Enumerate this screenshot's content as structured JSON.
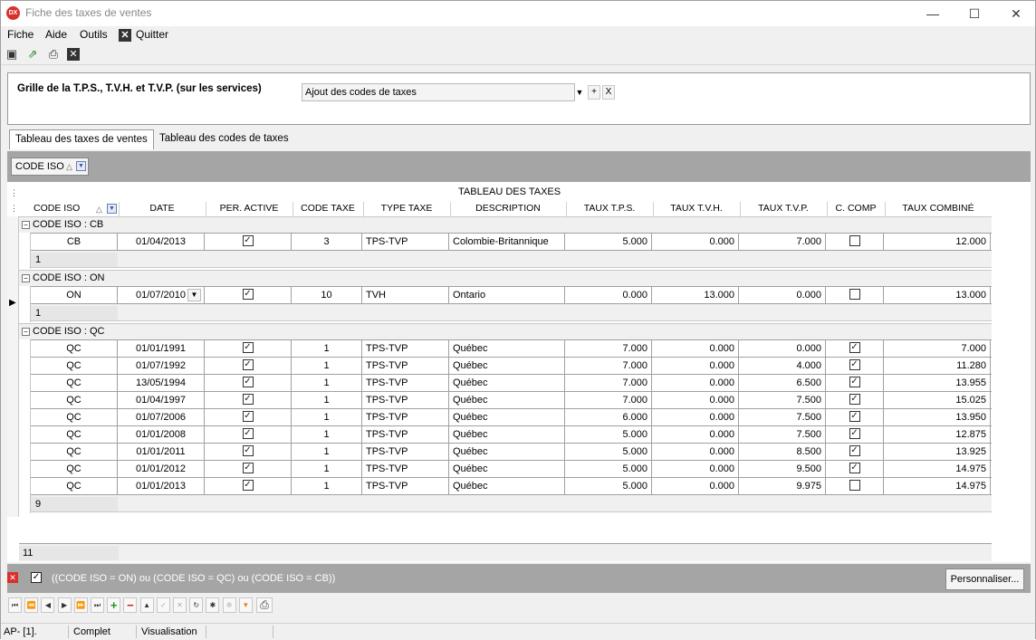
{
  "window": {
    "title": "Fiche des taxes de ventes",
    "app_icon": "DX",
    "minimize_icon": "minimize-icon",
    "maximize_icon": "maximize-icon",
    "close_icon": "close-icon"
  },
  "menu": {
    "items": [
      "Fiche",
      "Aide",
      "Outils",
      "Quitter"
    ]
  },
  "toolbar": {
    "icons": [
      "fit-window-icon",
      "export-icon",
      "print-icon",
      "close-icon"
    ]
  },
  "header": {
    "title": "Grille de la T.P.S., T.V.H. et T.V.P. (sur les services)",
    "combo_value": "Ajout des codes de taxes",
    "add_label": "+",
    "clear_label": "X"
  },
  "tabs": [
    "Tableau des taxes de ventes",
    "Tableau des codes de taxes"
  ],
  "group_panel": {
    "chip_label": "CODE ISO"
  },
  "grid": {
    "band_title": "TABLEAU DES TAXES",
    "columns": [
      "CODE ISO",
      "DATE",
      "PER. ACTIVE",
      "CODE TAXE",
      "TYPE TAXE",
      "DESCRIPTION",
      "TAUX T.P.S.",
      "TAUX T.V.H.",
      "TAUX T.V.P.",
      "C.  COMP",
      "TAUX COMBINÉ"
    ],
    "groups": [
      {
        "label": "CODE ISO : CB",
        "count": "1",
        "rows": [
          {
            "iso": "CB",
            "date": "01/04/2013",
            "active": true,
            "code": "3",
            "type": "TPS-TVP",
            "desc": "Colombie-Britannique",
            "tps": "5.000",
            "tvh": "0.000",
            "tvp": "7.000",
            "comp": false,
            "total": "12.000"
          }
        ]
      },
      {
        "label": "CODE ISO : ON",
        "count": "1",
        "rows": [
          {
            "iso": "ON",
            "date": "01/07/2010",
            "active": true,
            "code": "10",
            "type": "TVH",
            "desc": "Ontario",
            "tps": "0.000",
            "tvh": "13.000",
            "tvp": "0.000",
            "comp": false,
            "total": "13.000",
            "focused": true
          }
        ]
      },
      {
        "label": "CODE ISO : QC",
        "count": "9",
        "rows": [
          {
            "iso": "QC",
            "date": "01/01/1991",
            "active": true,
            "code": "1",
            "type": "TPS-TVP",
            "desc": "Québec",
            "tps": "7.000",
            "tvh": "0.000",
            "tvp": "0.000",
            "comp": true,
            "total": "7.000"
          },
          {
            "iso": "QC",
            "date": "01/07/1992",
            "active": true,
            "code": "1",
            "type": "TPS-TVP",
            "desc": "Québec",
            "tps": "7.000",
            "tvh": "0.000",
            "tvp": "4.000",
            "comp": true,
            "total": "11.280"
          },
          {
            "iso": "QC",
            "date": "13/05/1994",
            "active": true,
            "code": "1",
            "type": "TPS-TVP",
            "desc": "Québec",
            "tps": "7.000",
            "tvh": "0.000",
            "tvp": "6.500",
            "comp": true,
            "total": "13.955"
          },
          {
            "iso": "QC",
            "date": "01/04/1997",
            "active": true,
            "code": "1",
            "type": "TPS-TVP",
            "desc": "Québec",
            "tps": "7.000",
            "tvh": "0.000",
            "tvp": "7.500",
            "comp": true,
            "total": "15.025"
          },
          {
            "iso": "QC",
            "date": "01/07/2006",
            "active": true,
            "code": "1",
            "type": "TPS-TVP",
            "desc": "Québec",
            "tps": "6.000",
            "tvh": "0.000",
            "tvp": "7.500",
            "comp": true,
            "total": "13.950"
          },
          {
            "iso": "QC",
            "date": "01/01/2008",
            "active": true,
            "code": "1",
            "type": "TPS-TVP",
            "desc": "Québec",
            "tps": "5.000",
            "tvh": "0.000",
            "tvp": "7.500",
            "comp": true,
            "total": "12.875"
          },
          {
            "iso": "QC",
            "date": "01/01/2011",
            "active": true,
            "code": "1",
            "type": "TPS-TVP",
            "desc": "Québec",
            "tps": "5.000",
            "tvh": "0.000",
            "tvp": "8.500",
            "comp": true,
            "total": "13.925"
          },
          {
            "iso": "QC",
            "date": "01/01/2012",
            "active": true,
            "code": "1",
            "type": "TPS-TVP",
            "desc": "Québec",
            "tps": "5.000",
            "tvh": "0.000",
            "tvp": "9.500",
            "comp": true,
            "total": "14.975"
          },
          {
            "iso": "QC",
            "date": "01/01/2013",
            "active": true,
            "code": "1",
            "type": "TPS-TVP",
            "desc": "Québec",
            "tps": "5.000",
            "tvh": "0.000",
            "tvp": "9.975",
            "comp": false,
            "total": "14.975"
          }
        ]
      }
    ],
    "grand_total": "11"
  },
  "filter": {
    "text": "((CODE ISO = ON) ou (CODE ISO = QC) ou (CODE ISO = CB))",
    "customize_label": "Personnaliser..."
  },
  "navigator": {
    "buttons": [
      "first-icon",
      "prev-page-icon",
      "prev-icon",
      "next-icon",
      "next-page-icon",
      "last-icon",
      "insert-icon",
      "delete-icon",
      "edit-icon",
      "post-icon",
      "cancel-icon",
      "refresh-icon",
      "bookmark-icon",
      "goto-bookmark-icon",
      "filter-icon",
      "print-icon"
    ]
  },
  "status": {
    "cells": [
      "AP- [1].",
      "Complet",
      "Visualisation"
    ]
  },
  "colors": {
    "group_panel": "#a5a5a5",
    "accent_red": "#d9302c"
  }
}
